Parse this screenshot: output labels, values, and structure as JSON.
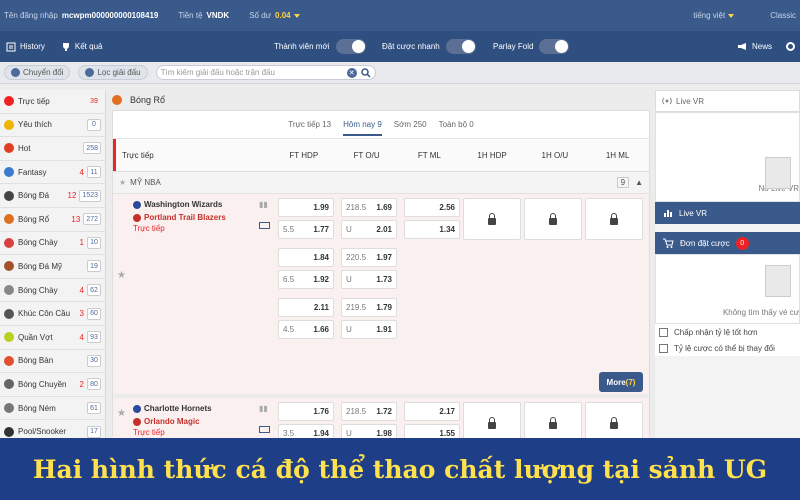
{
  "topbar": {
    "login_label": "Tên đăng nhập",
    "login_value": "mcwpm000000000108419",
    "currency_label": "Tiền tệ",
    "currency_value": "VNDK",
    "balance_label": "Số dư",
    "balance_value": "0.04",
    "language": "tiếng việt",
    "theme": "Classic"
  },
  "navbar": {
    "history": "History",
    "results": "Kết quả",
    "new_member": "Thành viên mới",
    "quick_bet": "Đặt cược nhanh",
    "parlay_fold": "Parlay Fold",
    "news": "News"
  },
  "filterbar": {
    "switch_label": "Chuyển đổi",
    "league_filter": "Lọc giải đấu",
    "search_placeholder": "Tìm kiếm giải đấu hoặc trận đấu"
  },
  "sidebar": {
    "items": [
      {
        "label": "Trực tiếp",
        "red": "",
        "count": "39",
        "count_red": true,
        "color": "#e22"
      },
      {
        "label": "Yêu thích",
        "red": "",
        "count": "0",
        "count_red": false,
        "color": "#f0b400"
      },
      {
        "label": "Hot",
        "red": "",
        "count": "258",
        "count_red": false,
        "color": "#e04020"
      },
      {
        "label": "Fantasy",
        "red": "4",
        "count": "11",
        "count_red": false,
        "color": "#3a7ad0"
      },
      {
        "label": "Bóng Đá",
        "red": "12",
        "count": "1523",
        "count_red": false,
        "color": "#444"
      },
      {
        "label": "Bóng Rổ",
        "red": "13",
        "count": "272",
        "count_red": false,
        "color": "#e07020"
      },
      {
        "label": "Bóng Chày",
        "red": "1",
        "count": "10",
        "count_red": false,
        "color": "#d84040"
      },
      {
        "label": "Bóng Đá Mỹ",
        "red": "",
        "count": "19",
        "count_red": false,
        "color": "#a0522d"
      },
      {
        "label": "Bóng Chày",
        "red": "4",
        "count": "62",
        "count_red": false,
        "color": "#888"
      },
      {
        "label": "Khúc Côn Cầu",
        "red": "3",
        "count": "60",
        "count_red": false,
        "color": "#555"
      },
      {
        "label": "Quần Vợt",
        "red": "4",
        "count": "93",
        "count_red": false,
        "color": "#b8d020"
      },
      {
        "label": "Bóng Bàn",
        "red": "",
        "count": "30",
        "count_red": false,
        "color": "#e05030"
      },
      {
        "label": "Bóng Chuyền",
        "red": "2",
        "count": "80",
        "count_red": false,
        "color": "#666"
      },
      {
        "label": "Bóng Ném",
        "red": "",
        "count": "61",
        "count_red": false,
        "color": "#777"
      },
      {
        "label": "Pool/Snooker",
        "red": "",
        "count": "17",
        "count_red": false,
        "color": "#333"
      }
    ]
  },
  "main": {
    "sport": "Bóng Rổ",
    "tabs": [
      "Trực tiếp 13",
      "Hôm nay 9",
      "Sớm 250",
      "Toàn bộ 0"
    ],
    "columns": [
      "Trực tiếp",
      "FT HDP",
      "FT O/U",
      "FT ML",
      "1H HDP",
      "1H O/U",
      "1H ML"
    ],
    "league": "MỸ NBA",
    "league_count": "9",
    "more_label": "More",
    "more_count": "(7)",
    "match1": {
      "home": "Washington Wizards",
      "away": "Portland Trail Blazers",
      "status": "Trực tiếp",
      "lines": [
        {
          "hdp_l": "",
          "hdp_h": "1.99",
          "ou_l": "218.5",
          "ou_h": "1.69",
          "ml_h": "2.56",
          "hdp_l2": "5.5",
          "hdp_a": "1.77",
          "ou_l2": "U",
          "ou_a": "2.01",
          "ml_a": "1.34"
        },
        {
          "hdp_l": "",
          "hdp_h": "1.84",
          "ou_l": "220.5",
          "ou_h": "1.97",
          "ml_h": "",
          "hdp_l2": "6.5",
          "hdp_a": "1.92",
          "ou_l2": "U",
          "ou_a": "1.73",
          "ml_a": ""
        },
        {
          "hdp_l": "",
          "hdp_h": "2.11",
          "ou_l": "219.5",
          "ou_h": "1.79",
          "ml_h": "",
          "hdp_l2": "4.5",
          "hdp_a": "1.66",
          "ou_l2": "U",
          "ou_a": "1.91",
          "ml_a": ""
        }
      ]
    },
    "match2": {
      "home": "Charlotte Hornets",
      "away": "Orlando Magic",
      "status": "Trực tiếp",
      "lines": [
        {
          "hdp_l": "",
          "hdp_h": "1.76",
          "ou_l": "218.5",
          "ou_h": "1.72",
          "ml_h": "2.17",
          "hdp_l2": "3.5",
          "hdp_a": "1.94",
          "ou_l2": "U",
          "ou_a": "1.98",
          "ml_a": "1.55"
        }
      ]
    }
  },
  "right_panel": {
    "live_vr_title": "Live VR",
    "no_live_vr": "No Live VR",
    "live_vr_button": "Live VR",
    "bet_slip": "Đơn đặt cược",
    "bet_count": "0",
    "not_found": "Không tìm thấy vé cư",
    "accept_better": "Chấp nhận tỷ lệ tốt hơn",
    "odds_change": "Tỷ lệ cược có thể bị thay đổi"
  },
  "banner": {
    "text": "Hai hình thức cá độ thể thao chất lượng tại sảnh UG"
  }
}
